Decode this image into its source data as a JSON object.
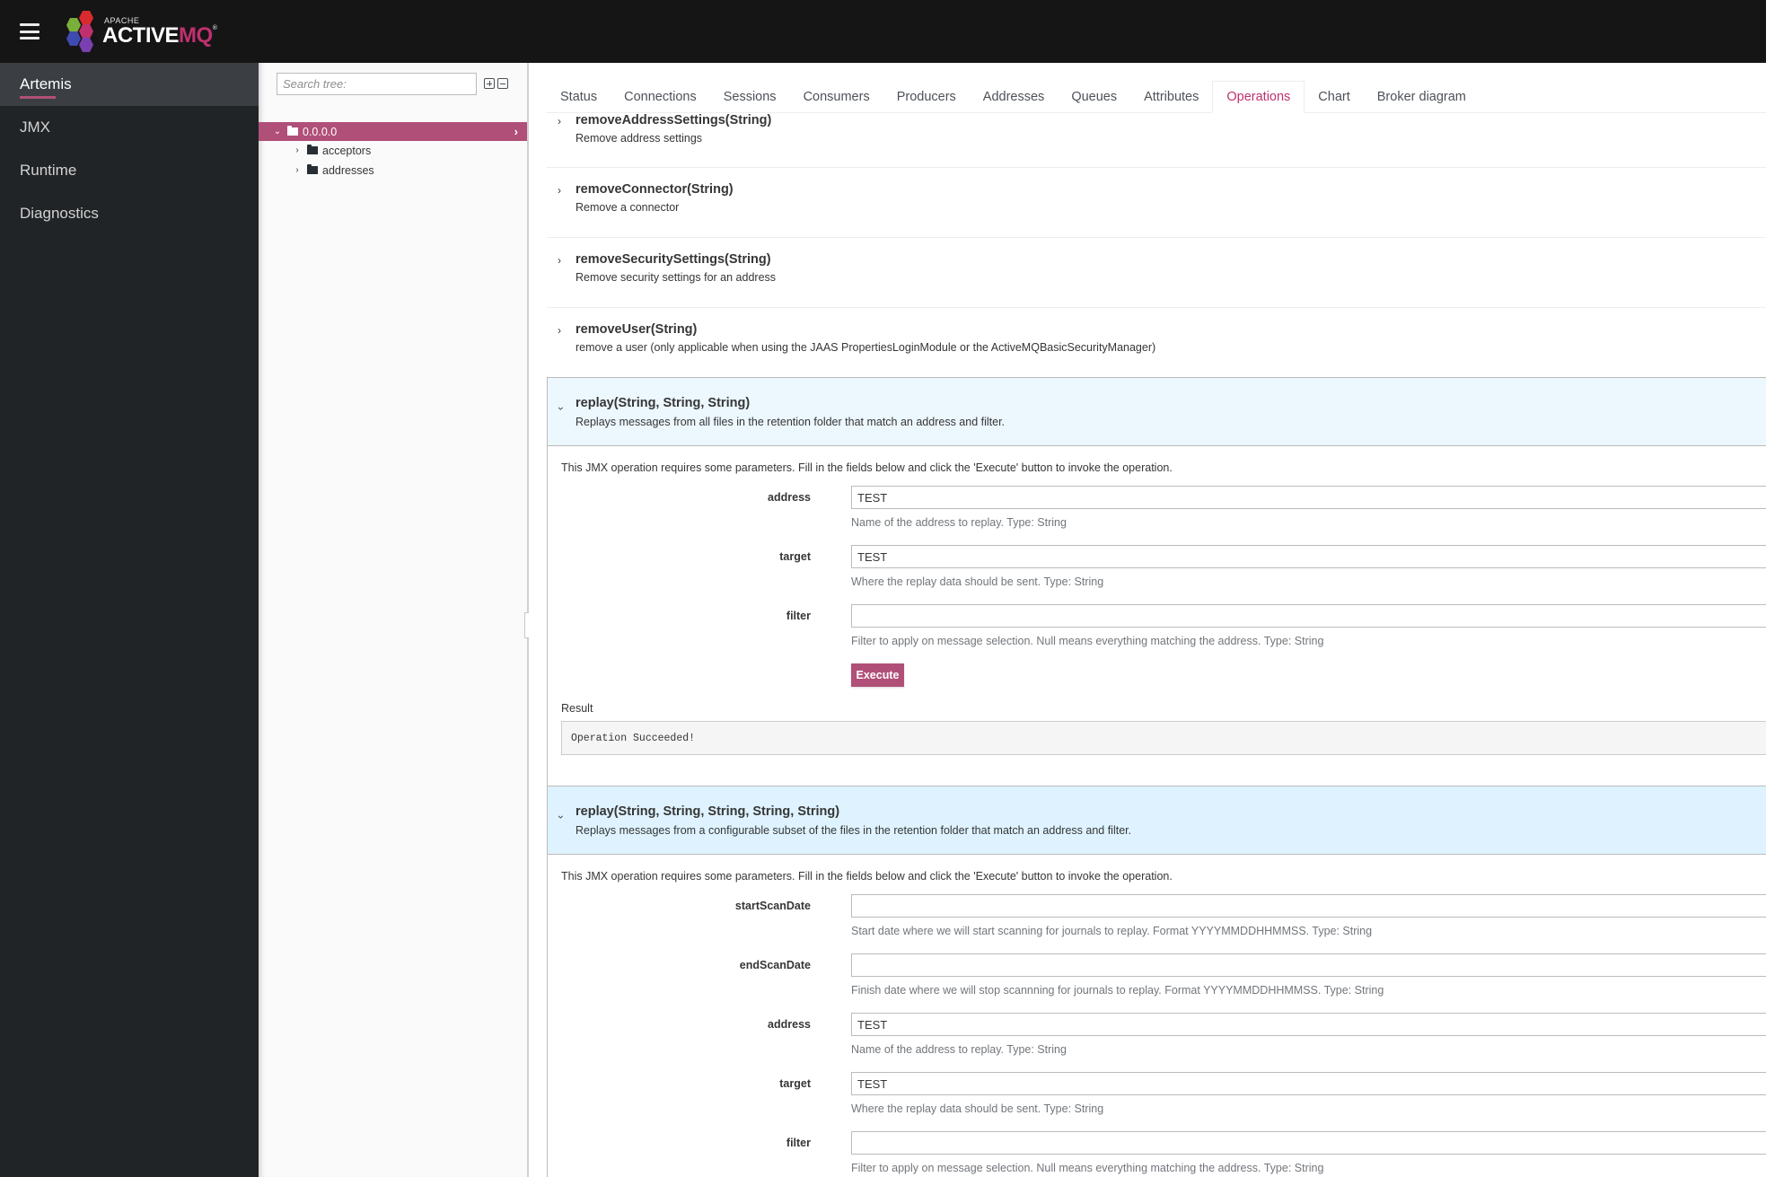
{
  "navbar": {
    "brand_apache": "APACHE",
    "brand_active": "ACTIVE",
    "brand_mq": "MQ",
    "brand_reg": "®",
    "menu_icon": "hamburger-icon",
    "colors": {
      "hex_green": "#7ab03a",
      "hex_red": "#d92b2f",
      "hex_pink": "#c0306f",
      "hex_blue": "#3f4bb0",
      "hex_purple": "#7a3fb0"
    }
  },
  "leftnav": {
    "items": [
      {
        "label": "Artemis",
        "active": true
      },
      {
        "label": "JMX",
        "active": false
      },
      {
        "label": "Runtime",
        "active": false
      },
      {
        "label": "Diagnostics",
        "active": false
      }
    ]
  },
  "tree": {
    "search_placeholder": "Search tree:",
    "expand_all_icon": "plus-square-icon",
    "collapse_all_icon": "minus-square-icon",
    "nodes": [
      {
        "label": "0.0.0.0",
        "expanded": true,
        "selected": true,
        "level": 0
      },
      {
        "label": "acceptors",
        "expanded": false,
        "selected": false,
        "level": 1
      },
      {
        "label": "addresses",
        "expanded": false,
        "selected": false,
        "level": 1
      }
    ]
  },
  "tabs": [
    {
      "label": "Status",
      "active": false
    },
    {
      "label": "Connections",
      "active": false
    },
    {
      "label": "Sessions",
      "active": false
    },
    {
      "label": "Consumers",
      "active": false
    },
    {
      "label": "Producers",
      "active": false
    },
    {
      "label": "Addresses",
      "active": false
    },
    {
      "label": "Queues",
      "active": false
    },
    {
      "label": "Attributes",
      "active": false
    },
    {
      "label": "Operations",
      "active": true
    },
    {
      "label": "Chart",
      "active": false
    },
    {
      "label": "Broker diagram",
      "active": false
    }
  ],
  "operations": [
    {
      "name": "removeAddressSettings(String)",
      "description": "Remove address settings",
      "expanded": false
    },
    {
      "name": "removeConnector(String)",
      "description": "Remove a connector",
      "expanded": false
    },
    {
      "name": "removeSecuritySettings(String)",
      "description": "Remove security settings for an address",
      "expanded": false
    },
    {
      "name": "removeUser(String)",
      "description": "remove a user (only applicable when using the JAAS PropertiesLoginModule or the ActiveMQBasicSecurityManager)",
      "expanded": false
    },
    {
      "name": "replay(String, String, String)",
      "description": "Replays messages from all files in the retention folder that match an address and filter.",
      "expanded": true,
      "intro": "This JMX operation requires some parameters. Fill in the fields below and click the 'Execute' button to invoke the operation.",
      "params": [
        {
          "label": "address",
          "value": "TEST",
          "help": "Name of the address to replay. Type: String"
        },
        {
          "label": "target",
          "value": "TEST",
          "help": "Where the replay data should be sent. Type: String"
        },
        {
          "label": "filter",
          "value": "",
          "help": "Filter to apply on message selection. Null means everything matching the address. Type: String"
        }
      ],
      "execute_label": "Execute",
      "result_label": "Result",
      "result_text": "Operation Succeeded!"
    },
    {
      "name": "replay(String, String, String, String, String)",
      "description": "Replays messages from a configurable subset of the files in the retention folder that match an address and filter.",
      "expanded": true,
      "intro": "This JMX operation requires some parameters. Fill in the fields below and click the 'Execute' button to invoke the operation.",
      "params": [
        {
          "label": "startScanDate",
          "value": "",
          "help": "Start date where we will start scanning for journals to replay. Format YYYYMMDDHHMMSS. Type: String"
        },
        {
          "label": "endScanDate",
          "value": "",
          "help": "Finish date where we will stop scannning for journals to replay. Format YYYYMMDDHHMMSS. Type: String"
        },
        {
          "label": "address",
          "value": "TEST",
          "help": "Name of the address to replay. Type: String"
        },
        {
          "label": "target",
          "value": "TEST",
          "help": "Where the replay data should be sent. Type: String"
        },
        {
          "label": "filter",
          "value": "",
          "help": "Filter to apply on message selection. Null means everything matching the address. Type: String"
        }
      ]
    }
  ],
  "colors": {
    "accent": "#b04f78",
    "active_tab_text": "#c0306f",
    "navbar_bg": "#151515",
    "leftnav_bg": "#212427",
    "expanded_header_bg": "#def3ff"
  }
}
